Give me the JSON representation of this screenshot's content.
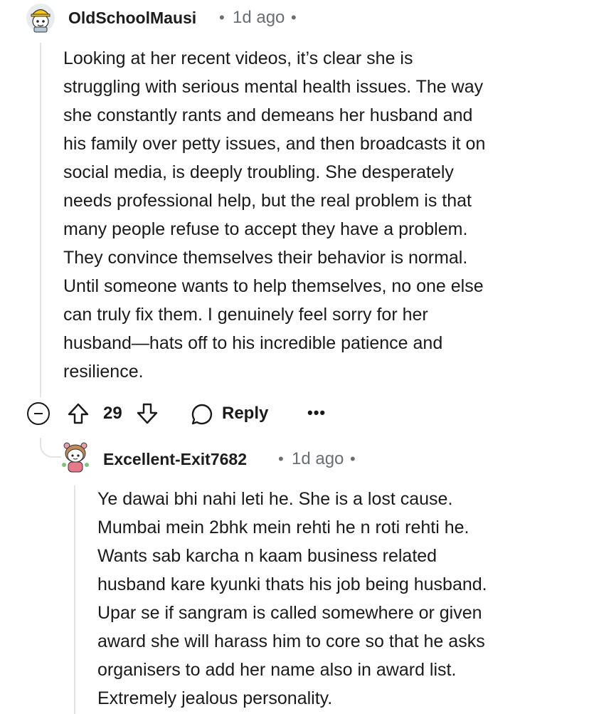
{
  "comment": {
    "username": "OldSchoolMausi",
    "separator": "•",
    "timestamp": "1d ago",
    "avatar_icon": "snoo-avatar-yellow-hat",
    "body_lines": [
      "Looking at her recent videos, it’s clear she is",
      "struggling with serious mental health issues. The way",
      "she constantly rants and demeans her husband and",
      "his family over petty issues, and then broadcasts it on",
      "social media, is deeply troubling. She desperately",
      "needs professional help, but the real problem is that",
      "many people refuse to accept they have a problem.",
      "They convince themselves their behavior is normal.",
      "Until someone wants to help themselves, no one else",
      "can truly fix them. I genuinely feel sorry for her",
      "husband—hats off to his incredible patience and",
      "resilience."
    ],
    "actions": {
      "collapse_icon": "collapse-minus-icon",
      "upvote_icon": "upvote-arrow-icon",
      "vote_count": "29",
      "downvote_icon": "downvote-arrow-icon",
      "reply_icon": "speech-bubble-icon",
      "reply_label": "Reply",
      "more_icon": "more-dots-icon",
      "more_label": "•••"
    }
  },
  "reply": {
    "username": "Excellent-Exit7682",
    "separator": "•",
    "timestamp": "1d ago",
    "avatar_icon": "snoo-avatar-girl",
    "body_lines": [
      "Ye dawai bhi nahi leti he. She is a lost cause.",
      "Mumbai mein 2bhk mein rehti he n roti rehti he.",
      "Wants sab karcha n kaam business related",
      "husband kare kyunki thats his job being husband.",
      "Upar se if sangram is called somewhere or given",
      "award she will harass him to core so that he asks",
      "organisers to add her name also in award list.",
      "Extremely jealous personality."
    ]
  },
  "colors": {
    "text": "#1a1a1b",
    "meta": "#6a6f73",
    "thread_line": "#e2e4e6",
    "background": "#ffffff"
  }
}
